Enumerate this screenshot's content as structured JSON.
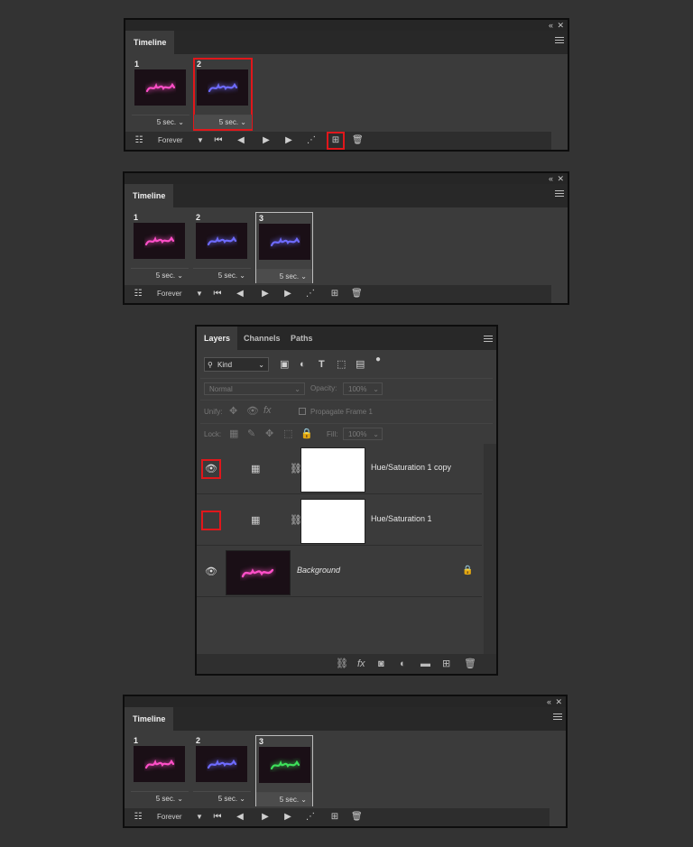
{
  "colors": {
    "highlight": "#e0171b",
    "panel": "#3b3b3b",
    "background": "#333333"
  },
  "timeline_panels": [
    {
      "title": "Timeline",
      "frames": [
        {
          "number": "1",
          "delay": "5 sec.",
          "glow": "#ff4fc8",
          "state": "normal"
        },
        {
          "number": "2",
          "delay": "5 sec.",
          "glow": "#6e6bff",
          "state": "selected-red"
        }
      ],
      "loop": "Forever"
    },
    {
      "title": "Timeline",
      "frames": [
        {
          "number": "1",
          "delay": "5 sec.",
          "glow": "#ff4fc8",
          "state": "normal"
        },
        {
          "number": "2",
          "delay": "5 sec.",
          "glow": "#6e6bff",
          "state": "normal"
        },
        {
          "number": "3",
          "delay": "5 sec.",
          "glow": "#6e6bff",
          "state": "selected-white"
        }
      ],
      "loop": "Forever"
    },
    {
      "title": "Timeline",
      "frames": [
        {
          "number": "1",
          "delay": "5 sec.",
          "glow": "#ff4fc8",
          "state": "normal"
        },
        {
          "number": "2",
          "delay": "5 sec.",
          "glow": "#6e6bff",
          "state": "normal"
        },
        {
          "number": "3",
          "delay": "5 sec.",
          "glow": "#3de05a",
          "state": "selected-white"
        }
      ],
      "loop": "Forever"
    }
  ],
  "layers_panel": {
    "tabs": [
      "Layers",
      "Channels",
      "Paths"
    ],
    "filter": "Kind",
    "blend_mode": "Normal",
    "opacity_label": "Opacity:",
    "opacity": "100%",
    "unify_label": "Unify:",
    "propagate_label": "Propagate Frame 1",
    "lock_label": "Lock:",
    "fill_label": "Fill:",
    "fill": "100%",
    "layers": [
      {
        "name": "Hue/Saturation 1 copy",
        "visible": true,
        "type": "adjustment"
      },
      {
        "name": "Hue/Saturation 1",
        "visible": false,
        "type": "adjustment"
      },
      {
        "name": "Background",
        "visible": true,
        "type": "image"
      }
    ]
  }
}
